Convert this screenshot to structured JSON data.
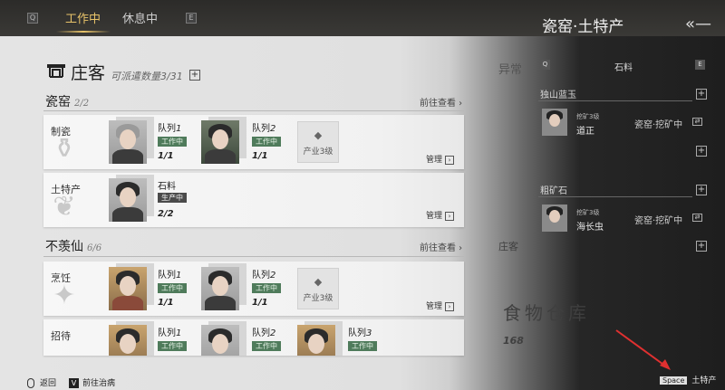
{
  "topbar": {
    "key_left": "Q",
    "tabs": [
      {
        "label": "工作中",
        "active": true
      },
      {
        "label": "休息中",
        "active": false
      }
    ],
    "key_right": "E"
  },
  "manor": {
    "title": "庄客",
    "dispatch_label": "可派遣数量",
    "dispatch_value": "3/31",
    "add": "+"
  },
  "groups": [
    {
      "title": "瓷窑",
      "count": "2/2",
      "goto": "前往查看",
      "cards": [
        {
          "name": "制瓷",
          "queues": [
            {
              "label": "队列",
              "num": "1",
              "status": "工作中",
              "ratio": "1/1"
            },
            {
              "label": "队列",
              "num": "2",
              "status": "工作中",
              "ratio": "1/1"
            }
          ],
          "locked": {
            "label": "产业3级"
          },
          "manage": "管理"
        },
        {
          "name": "土特产",
          "resource": "石料",
          "status": "生产中",
          "ratio": "2/2",
          "manage": "管理"
        }
      ]
    },
    {
      "title": "不羡仙",
      "count": "6/6",
      "goto": "前往查看",
      "cards": [
        {
          "name": "烹饪",
          "queues": [
            {
              "label": "队列",
              "num": "1",
              "status": "工作中",
              "ratio": "1/1"
            },
            {
              "label": "队列",
              "num": "2",
              "status": "工作中",
              "ratio": "1/1"
            }
          ],
          "locked": {
            "label": "产业3级"
          },
          "manage": "管理"
        },
        {
          "name": "招待",
          "queues": [
            {
              "label": "队列",
              "num": "1",
              "status": "工作中"
            },
            {
              "label": "队列",
              "num": "2",
              "status": "工作中"
            },
            {
              "label": "队列",
              "num": "3",
              "status": "工作中"
            }
          ]
        }
      ]
    }
  ],
  "bottom": {
    "back": "返回",
    "heal_key": "V",
    "heal": "前往治病"
  },
  "panel": {
    "title": "瓷窑·土特产",
    "back_icon": "«—",
    "faded_title": "异常",
    "tab_key_left": "Q",
    "tab_label": "石料",
    "tab_key_right": "E",
    "sections": [
      {
        "title": "独山蓝玉",
        "workers": [
          {
            "level": "挖矿3级",
            "name": "道正",
            "job": "瓷窑·挖矿中"
          }
        ]
      },
      {
        "title": "粗矿石",
        "workers": [
          {
            "level": "挖矿3级",
            "name": "海长虫",
            "job": "瓷窑·挖矿中"
          }
        ]
      }
    ],
    "ghost_food_title": "食物仓库",
    "ghost_food_value": "168",
    "ghost_manor": "庄客",
    "space_key": "Space",
    "space_label": "土特产"
  },
  "colors": {
    "accent": "#e9c46a",
    "status_green": "#4f7b5b",
    "panel_bg": "#1e1e1e"
  }
}
